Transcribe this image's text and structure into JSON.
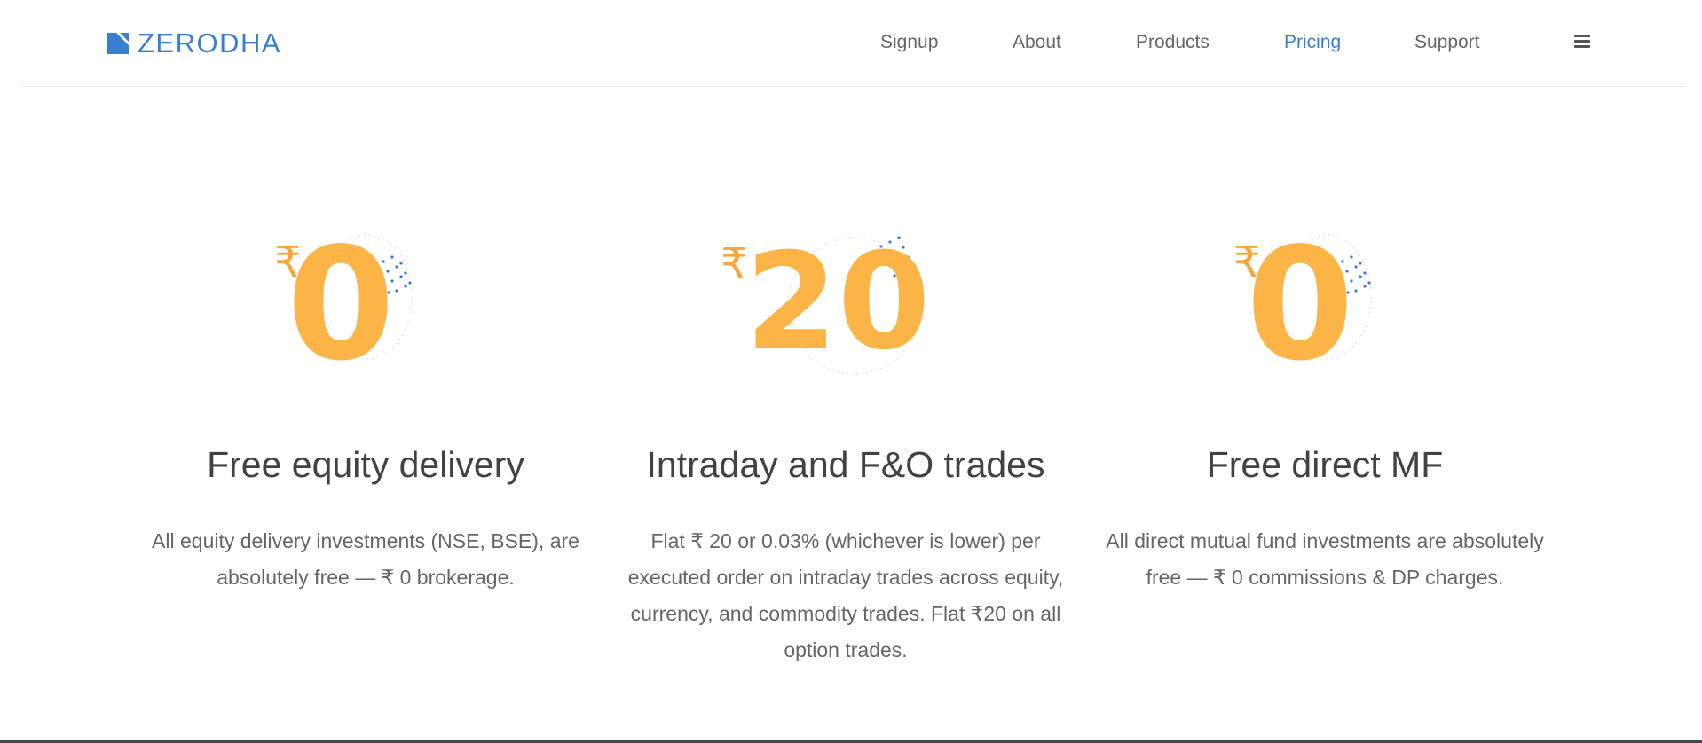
{
  "brand": {
    "name": "ZERODHA",
    "color": "#387ed1",
    "icon": "zerodha-logo-mark"
  },
  "nav": {
    "items": [
      {
        "label": "Signup",
        "active": false
      },
      {
        "label": "About",
        "active": false
      },
      {
        "label": "Products",
        "active": false
      },
      {
        "label": "Pricing",
        "active": true
      },
      {
        "label": "Support",
        "active": false
      }
    ],
    "menu_icon": "hamburger-menu-icon"
  },
  "colors": {
    "accent": "#387ed1",
    "price": "#fcb447",
    "text": "#424242",
    "muted": "#666666"
  },
  "cards": [
    {
      "currency": "₹",
      "amount": "0",
      "title": "Free equity delivery",
      "description": "All equity delivery investments (NSE, BSE), are absolutely free — ₹ 0 brokerage."
    },
    {
      "currency": "₹",
      "amount": "20",
      "title": "Intraday and F&O trades",
      "description": "Flat ₹ 20 or 0.03% (whichever is lower) per executed order on intraday trades across equity, currency, and commodity trades. Flat ₹20 on all option trades."
    },
    {
      "currency": "₹",
      "amount": "0",
      "title": "Free direct MF",
      "description": "All direct mutual fund investments are absolutely free — ₹ 0 commissions & DP charges."
    }
  ]
}
